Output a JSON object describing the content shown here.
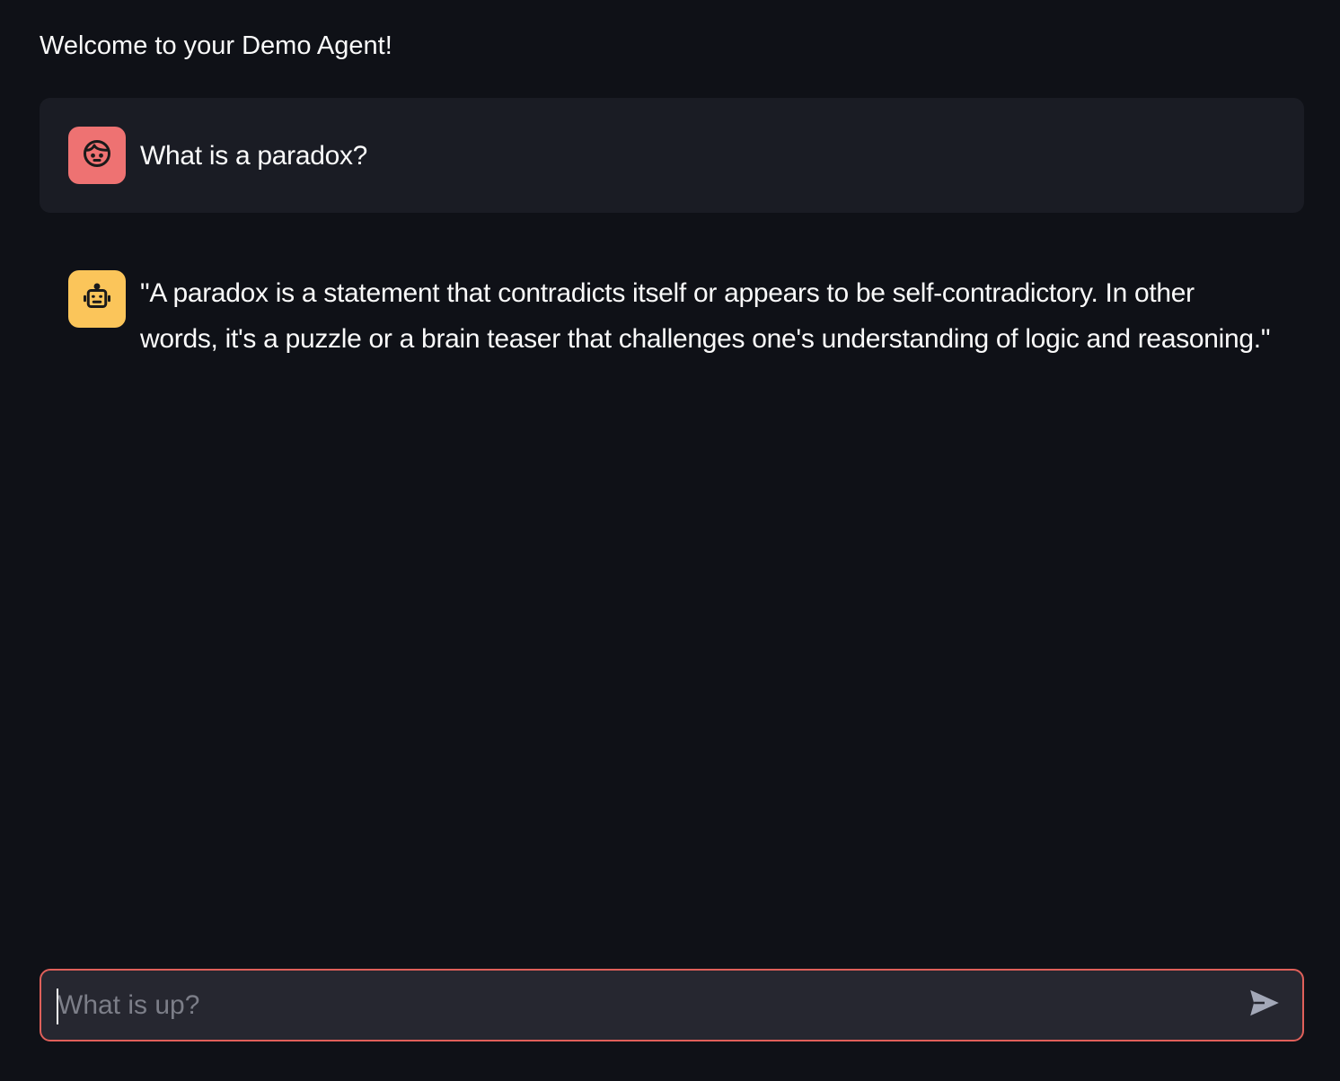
{
  "app": {
    "title": "Welcome to your Demo Agent!"
  },
  "messages": [
    {
      "role": "user",
      "avatar_icon": "face-icon",
      "avatar_color": "#ee7272",
      "text": "What is a paradox?"
    },
    {
      "role": "assistant",
      "avatar_icon": "robot-icon",
      "avatar_color": "#fbc55a",
      "text": "\"A paradox is a statement that contradicts itself or appears to be self-contradictory. In other words, it's a puzzle or a brain teaser that challenges one's understanding of logic and reasoning.\""
    }
  ],
  "chat_input": {
    "placeholder": "What is up?",
    "value": "",
    "border_color": "#e0605a",
    "send_icon": "send-icon"
  },
  "colors": {
    "background": "#0f1117",
    "user_message_bg": "#1a1c24",
    "input_bg": "#262730"
  }
}
